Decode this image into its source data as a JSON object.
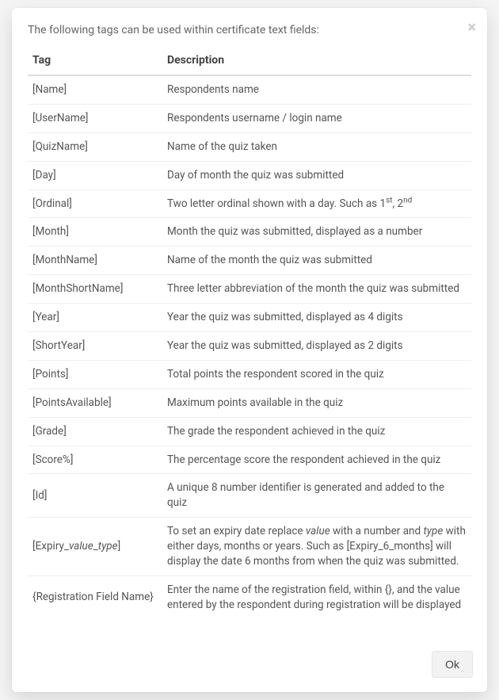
{
  "intro": "The following tags can be used within certificate text fields:",
  "columns": {
    "tag": "Tag",
    "description": "Description"
  },
  "rows": [
    {
      "tag": "[Name]",
      "desc": "Respondents name"
    },
    {
      "tag": "[UserName]",
      "desc": "Respondents username / login name"
    },
    {
      "tag": "[QuizName]",
      "desc": "Name of the quiz taken"
    },
    {
      "tag": "[Day]",
      "desc": "Day of month the quiz was submitted"
    },
    {
      "tag": "[Ordinal]",
      "desc_html": "Two letter ordinal shown with a day. Such as 1<sup>st</sup>, 2<sup>nd</sup>"
    },
    {
      "tag": "[Month]",
      "desc": "Month the quiz was submitted, displayed as a number"
    },
    {
      "tag": "[MonthName]",
      "desc": "Name of the month the quiz was submitted"
    },
    {
      "tag": "[MonthShortName]",
      "desc": "Three letter abbreviation of the month the quiz was submitted"
    },
    {
      "tag": "[Year]",
      "desc": "Year the quiz was submitted, displayed as 4 digits"
    },
    {
      "tag": "[ShortYear]",
      "desc": "Year the quiz was submitted, displayed as 2 digits"
    },
    {
      "tag": "[Points]",
      "desc": "Total points the respondent scored in the quiz"
    },
    {
      "tag": "[PointsAvailable]",
      "desc": "Maximum points available in the quiz"
    },
    {
      "tag": "[Grade]",
      "desc": "The grade the respondent achieved in the quiz"
    },
    {
      "tag": "[Score%]",
      "desc": "The percentage score the respondent achieved in the quiz"
    },
    {
      "tag": "[Id]",
      "desc": "A unique 8 number identifier is generated and added to the quiz"
    },
    {
      "tag_html": "[Expiry_<em>value</em>_<em>type</em>]",
      "desc_html": "To set an expiry date replace <em>value</em> with a number and <em>type</em> with either days, months or years. Such as [Expiry_6_months] will display the date 6 months from when the quiz was submitted."
    },
    {
      "tag": "{Registration Field Name}",
      "desc": "Enter the name of the registration field, within {}, and the value entered by the respondent during registration will be displayed"
    }
  ],
  "ok_label": "Ok"
}
